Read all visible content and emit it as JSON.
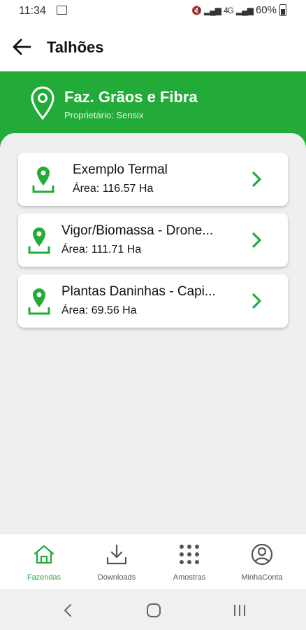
{
  "status_bar": {
    "time": "11:34",
    "battery": "60%",
    "network": "4G"
  },
  "header": {
    "title": "Talhões"
  },
  "farm": {
    "name": "Faz. Grãos e Fibra",
    "owner": "Proprietário: Sensix"
  },
  "fields": [
    {
      "name": "Exemplo Termal",
      "area": "Área: 116.57 Ha"
    },
    {
      "name": "Vigor/Biomassa - Drone...",
      "area": "Área: 111.71 Ha"
    },
    {
      "name": "Plantas Daninhas - Capi...",
      "area": "Área: 69.56 Ha"
    }
  ],
  "bottom_nav": {
    "items": [
      {
        "label": "Fazendas",
        "icon": "home-icon",
        "active": true
      },
      {
        "label": "Downloads",
        "icon": "download-icon",
        "active": false
      },
      {
        "label": "Amostras",
        "icon": "grid-dots-icon",
        "active": false
      },
      {
        "label": "MinhaConta",
        "icon": "account-icon",
        "active": false
      }
    ]
  },
  "colors": {
    "accent": "#22ab38",
    "background": "#efefef",
    "card": "#ffffff"
  }
}
